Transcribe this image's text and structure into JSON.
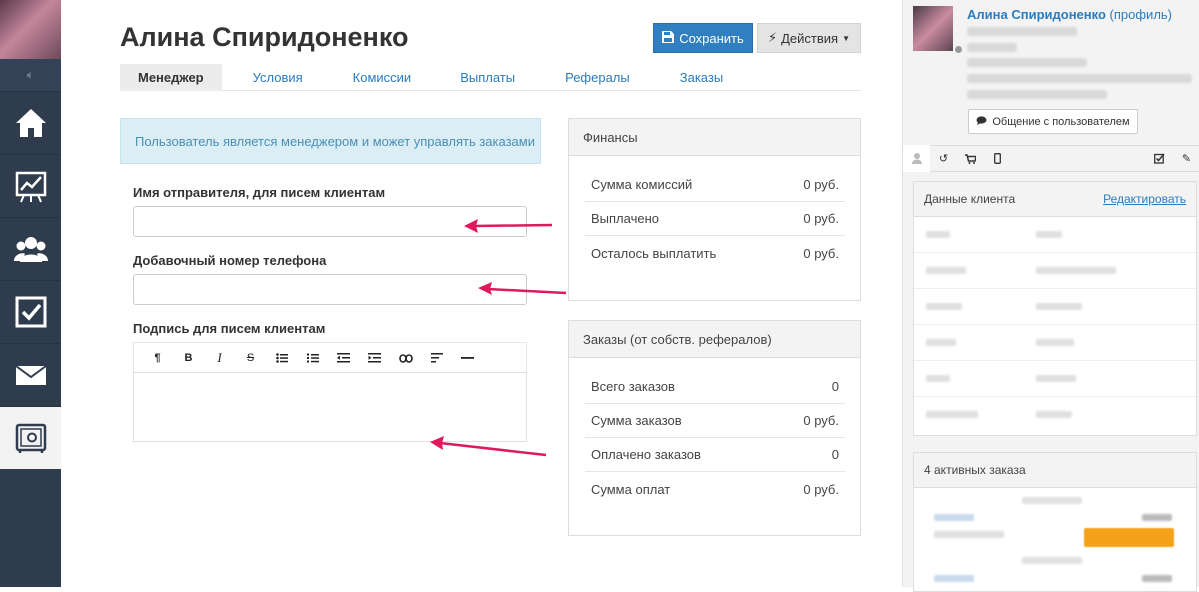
{
  "page": {
    "title": "Алина Спиридоненко",
    "save_label": "Сохранить",
    "actions_label": "Действия"
  },
  "tabs": [
    "Менеджер",
    "Условия",
    "Комиссии",
    "Выплаты",
    "Рефералы",
    "Заказы"
  ],
  "active_tab": "Менеджер",
  "info_message": "Пользователь является менеджером и может управлять заказами",
  "form": {
    "sender_name_label": "Имя отправителя, для писем клиентам",
    "sender_name_value": "",
    "ext_phone_label": "Добавочный номер телефона",
    "ext_phone_value": "",
    "signature_label": "Подпись для писем клиентам",
    "signature_value": ""
  },
  "editor_toolbar": [
    "¶",
    "B",
    "I",
    "S",
    "•",
    "1.",
    "⇤",
    "⇥",
    "link",
    "align",
    "—"
  ],
  "finance": {
    "title": "Финансы",
    "rows": [
      {
        "label": "Сумма комиссий",
        "value": "0 руб."
      },
      {
        "label": "Выплачено",
        "value": "0 руб."
      },
      {
        "label": "Осталось выплатить",
        "value": "0 руб."
      }
    ]
  },
  "orders": {
    "title": "Заказы (от собств. рефералов)",
    "rows": [
      {
        "label": "Всего заказов",
        "value": "0"
      },
      {
        "label": "Сумма заказов",
        "value": "0 руб."
      },
      {
        "label": "Оплачено заказов",
        "value": "0"
      },
      {
        "label": "Сумма оплат",
        "value": "0 руб."
      }
    ]
  },
  "sidebar": {
    "user_name": "Алина Спиридоненко",
    "profile_link": "(профиль)",
    "chat_button": "Общение с пользователем",
    "client_data_title": "Данные клиента",
    "edit_link": "Редактировать",
    "active_orders_title": "4 активных заказа"
  },
  "colors": {
    "primary": "#2f7fc1",
    "sidebar_bg": "#2f3c4d",
    "arrow": "#e0195a",
    "info_bg": "#dbeef6"
  }
}
